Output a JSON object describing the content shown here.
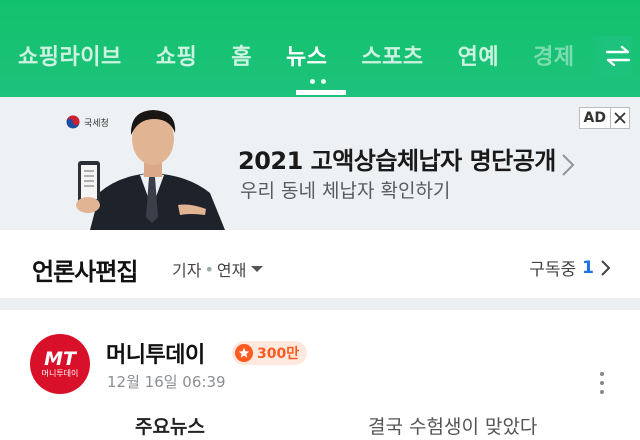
{
  "nav": {
    "tabs": [
      {
        "label": "쇼핑라이브"
      },
      {
        "label": "쇼핑"
      },
      {
        "label": "홈"
      },
      {
        "label": "뉴스"
      },
      {
        "label": "스포츠"
      },
      {
        "label": "연예"
      },
      {
        "label": "경제"
      }
    ],
    "active_index": 3,
    "icons": [
      "swap-arrows-icon"
    ]
  },
  "ad": {
    "logo_text": "국세청",
    "title": "2021 고액상습체납자 명단공개",
    "subtitle": "우리 동네 체납자 확인하기",
    "badge_label": "AD",
    "icons": [
      "close-icon",
      "chevron-right-icon"
    ]
  },
  "section": {
    "title": "언론사편집",
    "filter_reporter": "기자",
    "filter_series": "연재",
    "subscribe_label": "구독중",
    "subscribe_count": "1"
  },
  "news_item": {
    "press_logo_text": "MT",
    "press_logo_subtext": "머니투데이",
    "press_name": "머니투데이",
    "subscriber_badge": "300만",
    "timestamp": "12월 16일 06:39",
    "main_news_label": "주요뉴스",
    "headline": "결국 수험생이 맞았다"
  },
  "colors": {
    "nav_green": "#1dc27c",
    "ad_background": "#eef1f3",
    "press_red": "#d8102a",
    "badge_orange": "#ff5a1f",
    "subscribe_blue": "#1a73e8"
  }
}
